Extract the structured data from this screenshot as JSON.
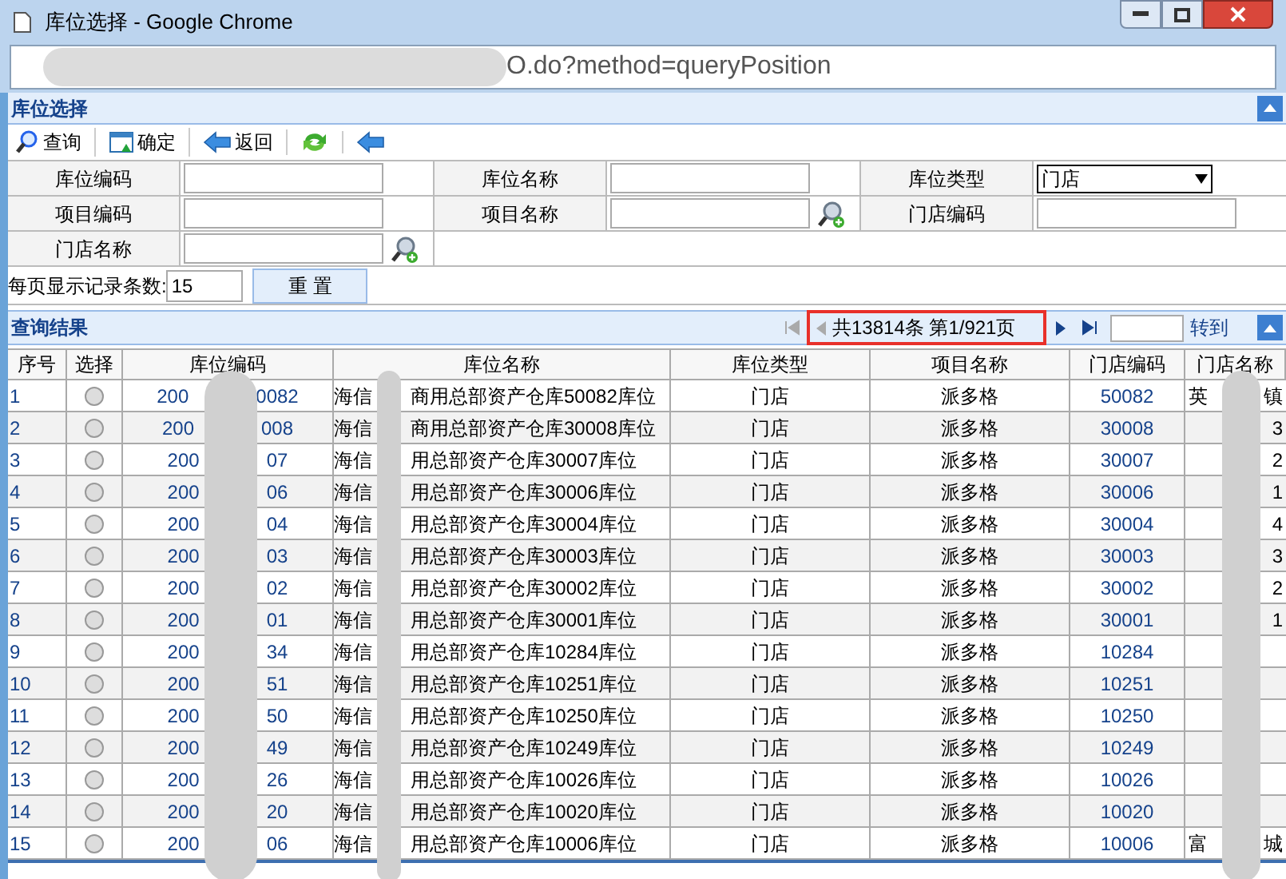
{
  "window": {
    "title": "库位选择 - Google Chrome"
  },
  "address_bar": {
    "url_visible": "O.do?method=queryPosition"
  },
  "panel": {
    "title": "库位选择"
  },
  "toolbar": [
    {
      "kind": "search",
      "label": "查询"
    },
    {
      "kind": "confirm",
      "label": "确定"
    },
    {
      "kind": "back",
      "label": "返回"
    },
    {
      "kind": "refresh"
    },
    {
      "kind": "back"
    }
  ],
  "form": {
    "rows": [
      [
        {
          "label": "库位编码",
          "kind": "text"
        },
        {
          "label": "库位名称",
          "kind": "text"
        },
        {
          "label": "库位类型",
          "kind": "select",
          "value": "门店"
        }
      ],
      [
        {
          "label": "项目编码",
          "kind": "text"
        },
        {
          "label": "项目名称",
          "kind": "lookup"
        },
        {
          "label": "门店编码",
          "kind": "text"
        }
      ],
      [
        {
          "label": "门店名称",
          "kind": "lookup"
        }
      ]
    ],
    "page_size_label": "每页显示记录条数:",
    "page_size": "15",
    "reset_button": "重 置"
  },
  "results": {
    "title": "查询结果",
    "pager": {
      "summary": "共13814条 第1/921页",
      "highlighted": true,
      "goto_button": "转到"
    },
    "columns": [
      "序号",
      "选择",
      "库位编码",
      "库位名称",
      "库位类型",
      "项目名称",
      "门店编码",
      "门店名称"
    ],
    "rows": [
      {
        "no": "1",
        "selected": false,
        "code_start": "200",
        "code_end": "0082",
        "name_start": "海信",
        "name_end": "商用总部资产仓库50082库位",
        "type": "门店",
        "project": "派多格",
        "store_code": "50082",
        "store_start": "英",
        "store_end": "镇"
      },
      {
        "no": "2",
        "selected": false,
        "code_start": "200",
        "code_end": "008",
        "name_start": "海信",
        "name_end": "商用总部资产仓库30008库位",
        "type": "门店",
        "project": "派多格",
        "store_code": "30008",
        "store_end": "3"
      },
      {
        "no": "3",
        "selected": false,
        "code_start": "200",
        "code_end": "07",
        "name_start": "海信",
        "name_end": "用总部资产仓库30007库位",
        "type": "门店",
        "project": "派多格",
        "store_code": "30007",
        "store_end": "2"
      },
      {
        "no": "4",
        "selected": false,
        "code_start": "200",
        "code_end": "06",
        "name_start": "海信",
        "name_end": "用总部资产仓库30006库位",
        "type": "门店",
        "project": "派多格",
        "store_code": "30006",
        "store_end": "1"
      },
      {
        "no": "5",
        "selected": false,
        "code_start": "200",
        "code_end": "04",
        "name_start": "海信",
        "name_end": "用总部资产仓库30004库位",
        "type": "门店",
        "project": "派多格",
        "store_code": "30004",
        "store_end": "4"
      },
      {
        "no": "6",
        "selected": false,
        "code_start": "200",
        "code_end": "03",
        "name_start": "海信",
        "name_end": "用总部资产仓库30003库位",
        "type": "门店",
        "project": "派多格",
        "store_code": "30003",
        "store_end": "3"
      },
      {
        "no": "7",
        "selected": false,
        "code_start": "200",
        "code_end": "02",
        "name_start": "海信",
        "name_end": "用总部资产仓库30002库位",
        "type": "门店",
        "project": "派多格",
        "store_code": "30002",
        "store_end": "2"
      },
      {
        "no": "8",
        "selected": false,
        "code_start": "200",
        "code_end": "01",
        "name_start": "海信",
        "name_end": "用总部资产仓库30001库位",
        "type": "门店",
        "project": "派多格",
        "store_code": "30001",
        "store_end": "1"
      },
      {
        "no": "9",
        "selected": false,
        "code_start": "200",
        "code_end": "34",
        "name_start": "海信",
        "name_end": "用总部资产仓库10284库位",
        "type": "门店",
        "project": "派多格",
        "store_code": "10284"
      },
      {
        "no": "10",
        "selected": false,
        "code_start": "200",
        "code_end": "51",
        "name_start": "海信",
        "name_end": "用总部资产仓库10251库位",
        "type": "门店",
        "project": "派多格",
        "store_code": "10251"
      },
      {
        "no": "11",
        "selected": false,
        "code_start": "200",
        "code_end": "50",
        "name_start": "海信",
        "name_end": "用总部资产仓库10250库位",
        "type": "门店",
        "project": "派多格",
        "store_code": "10250"
      },
      {
        "no": "12",
        "selected": false,
        "code_start": "200",
        "code_end": "49",
        "name_start": "海信",
        "name_end": "用总部资产仓库10249库位",
        "type": "门店",
        "project": "派多格",
        "store_code": "10249"
      },
      {
        "no": "13",
        "selected": false,
        "code_start": "200",
        "code_end": "26",
        "name_start": "海信",
        "name_end": "用总部资产仓库10026库位",
        "type": "门店",
        "project": "派多格",
        "store_code": "10026"
      },
      {
        "no": "14",
        "selected": false,
        "code_start": "200",
        "code_end": "20",
        "name_start": "海信",
        "name_end": "用总部资产仓库10020库位",
        "type": "门店",
        "project": "派多格",
        "store_code": "10020"
      },
      {
        "no": "15",
        "selected": false,
        "code_start": "200",
        "code_end": "06",
        "name_start": "海信",
        "name_end": "用总部资产仓库10006库位",
        "type": "门店",
        "project": "派多格",
        "store_code": "10006",
        "store_start": "富",
        "store_end": "城"
      }
    ]
  }
}
